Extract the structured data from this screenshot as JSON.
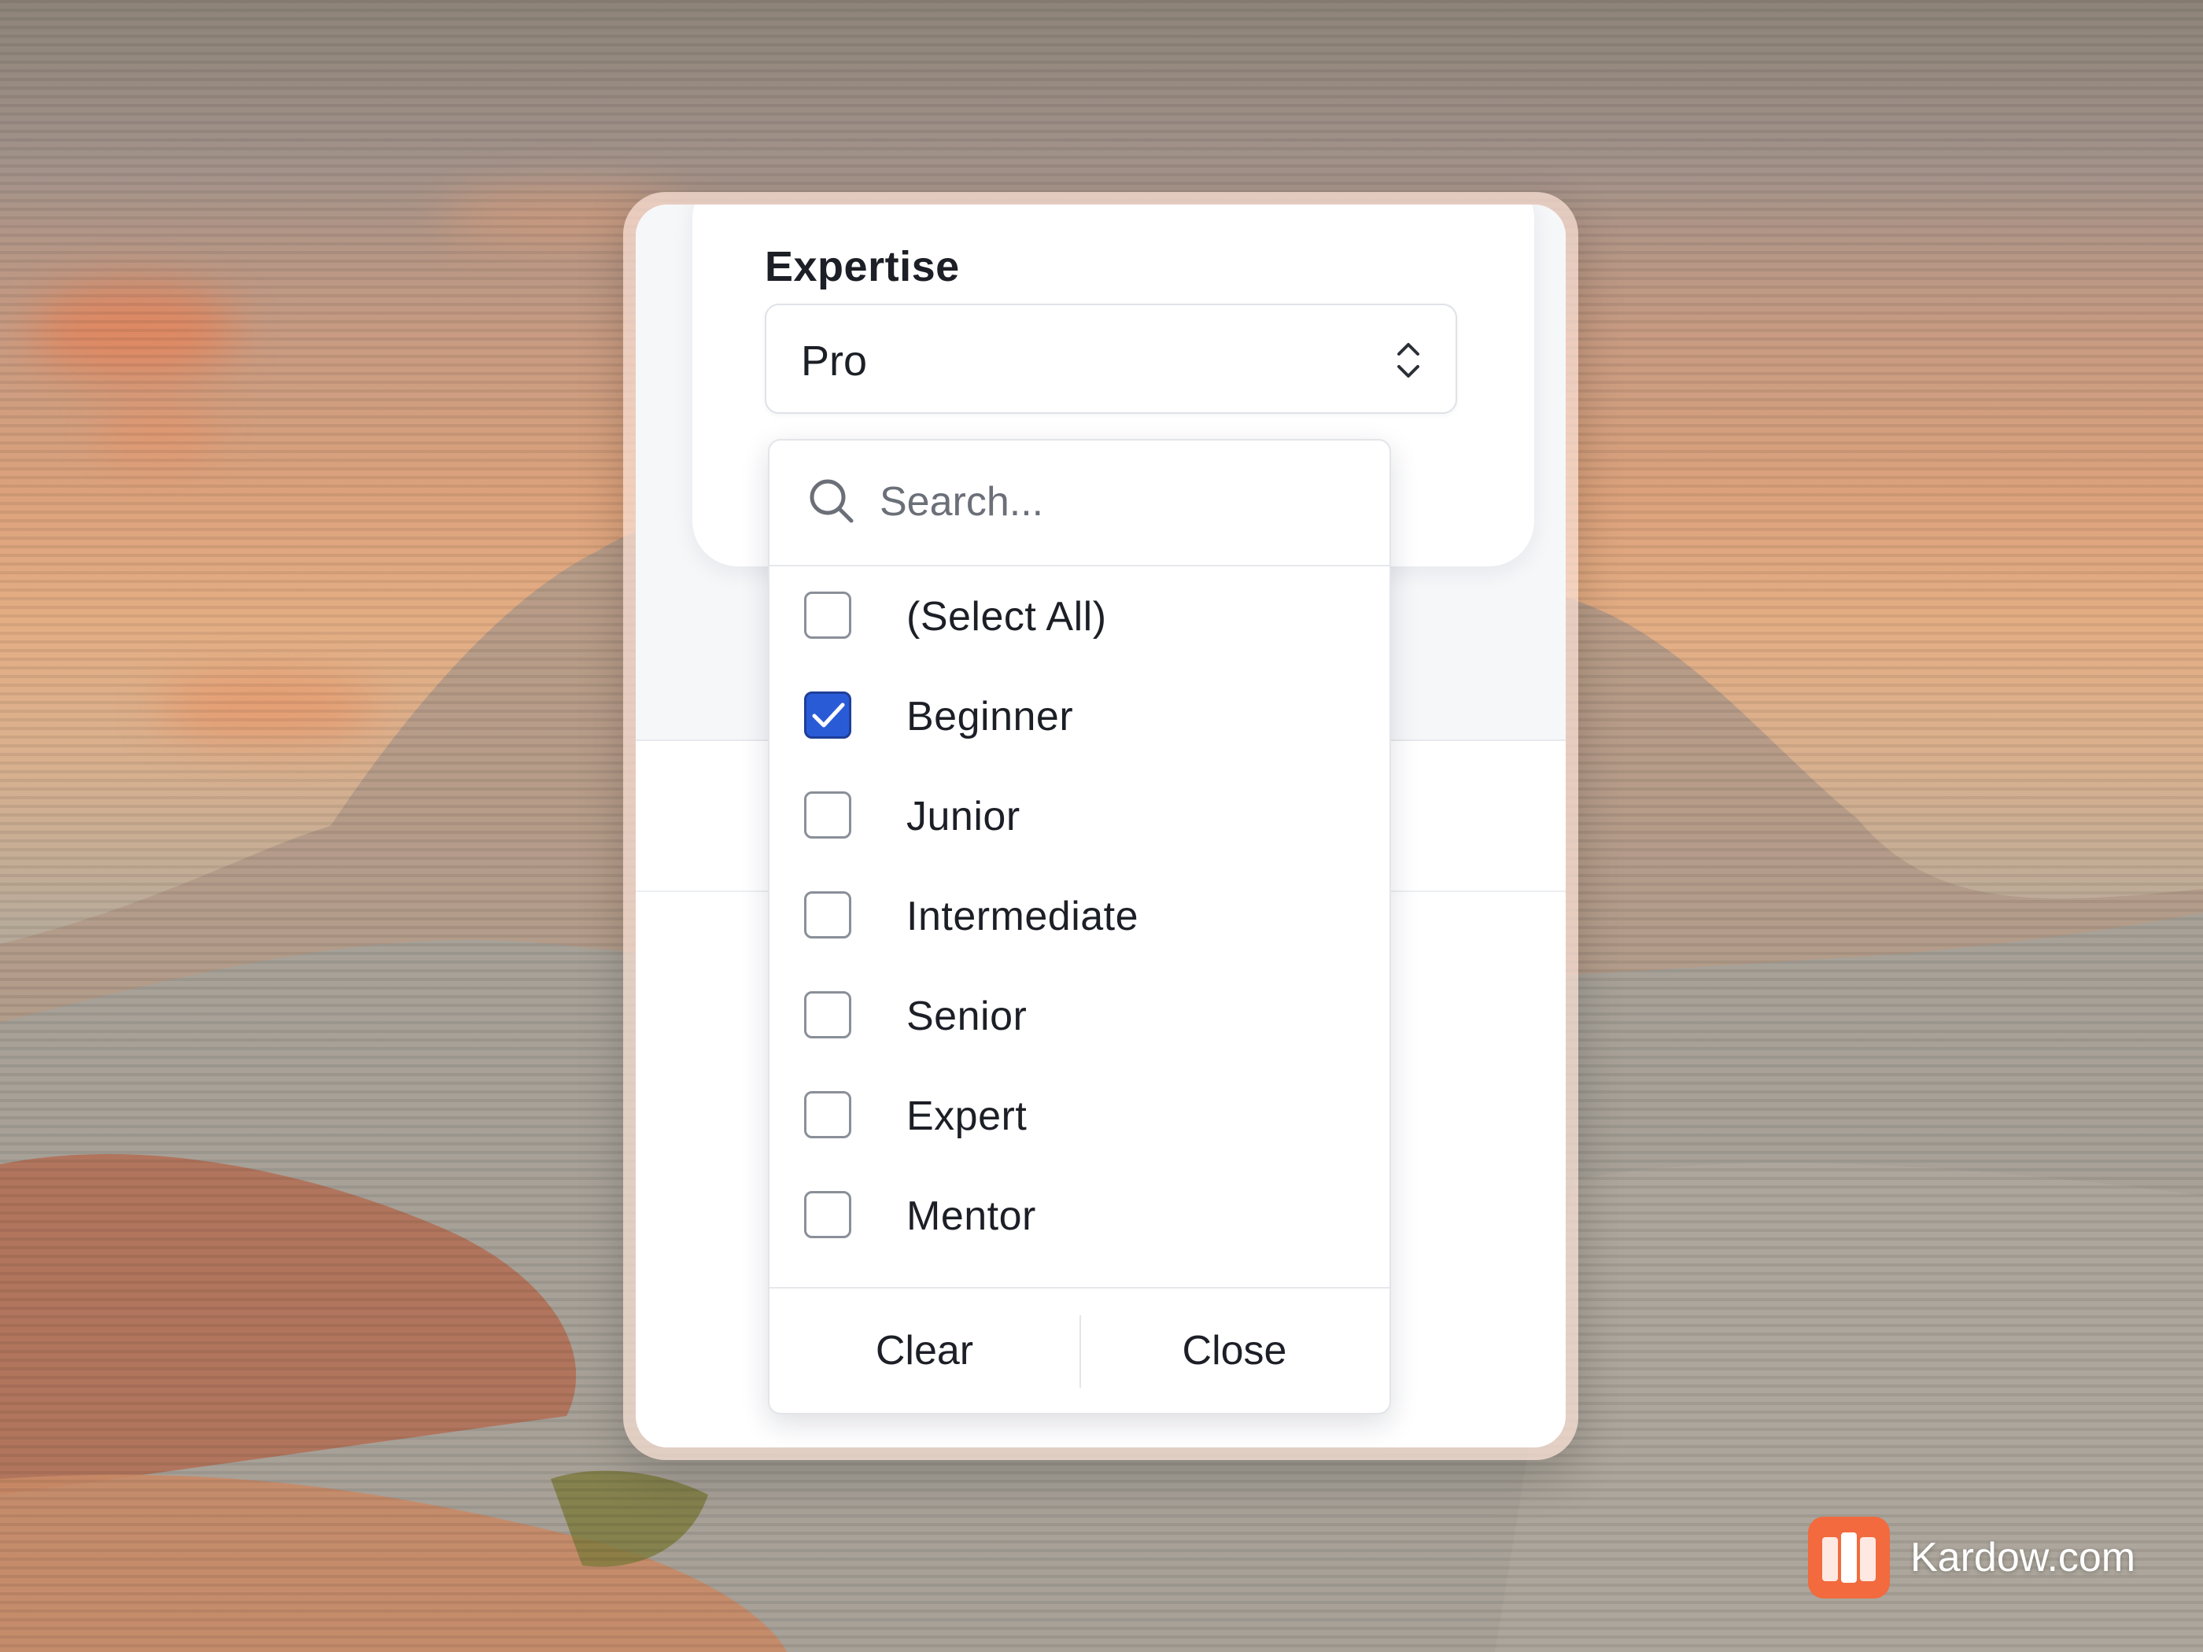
{
  "form": {
    "field_label": "Expertise",
    "selected_value": "Pro"
  },
  "dropdown": {
    "search_placeholder": "Search...",
    "options": [
      {
        "label": "(Select All)",
        "checked": false
      },
      {
        "label": "Beginner",
        "checked": true
      },
      {
        "label": "Junior",
        "checked": false
      },
      {
        "label": "Intermediate",
        "checked": false
      },
      {
        "label": "Senior",
        "checked": false
      },
      {
        "label": "Expert",
        "checked": false
      },
      {
        "label": "Mentor",
        "checked": false
      }
    ],
    "clear_label": "Clear",
    "close_label": "Close"
  },
  "brand": {
    "name": "Kardow.com"
  },
  "colors": {
    "checkbox_checked": "#2a5bd7",
    "brand_orange": "#f26a3d"
  },
  "icons": {
    "search": "search-icon",
    "chevron": "chevron-up-down-icon",
    "check": "check-icon"
  }
}
